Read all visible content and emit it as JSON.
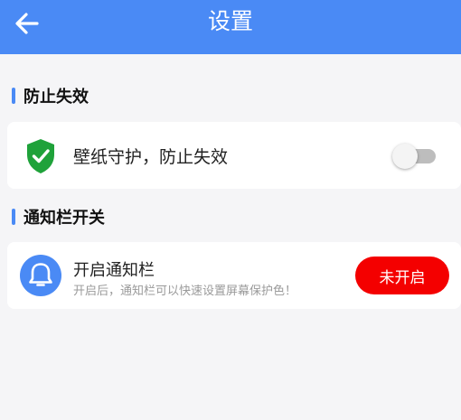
{
  "header": {
    "title": "设置",
    "back_icon": "arrow-left-icon",
    "color": "#4a8af5"
  },
  "sections": [
    {
      "title": "防止失效"
    },
    {
      "title": "通知栏开关"
    }
  ],
  "wallpaper_guard": {
    "label": "壁纸守护，防止失效",
    "icon": "shield-check-icon",
    "enabled": false
  },
  "notification": {
    "title": "开启通知栏",
    "description": "开启后，通知栏可以快速设置屏幕保护色！",
    "icon": "bell-icon",
    "status_label": "未开启",
    "status_color": "#f40000"
  }
}
